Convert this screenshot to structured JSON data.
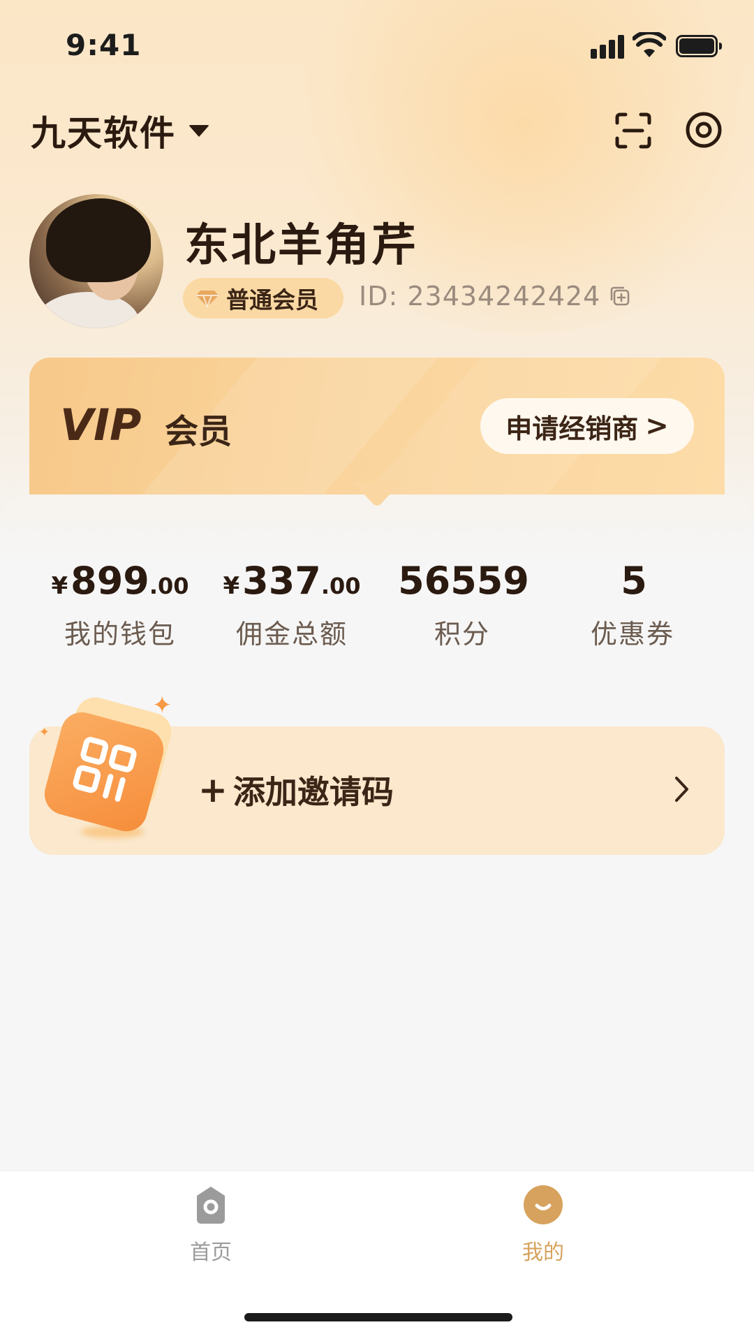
{
  "status_bar": {
    "time": "9:41"
  },
  "header": {
    "org_name": "九天软件"
  },
  "profile": {
    "name": "东北羊角芹",
    "member_level": "普通会员",
    "user_id": "ID: 23434242424"
  },
  "vip_card": {
    "logo_text": "VIP",
    "label": "会员",
    "apply_button": "申请经销商",
    "apply_chevron": ">"
  },
  "stats": [
    {
      "currency": "¥",
      "integer": "899",
      "decimal": ".00",
      "label": "我的钱包"
    },
    {
      "currency": "¥",
      "integer": "337",
      "decimal": ".00",
      "label": "佣金总额"
    },
    {
      "currency": "",
      "integer": "56559",
      "decimal": "",
      "label": "积分"
    },
    {
      "currency": "",
      "integer": "5",
      "decimal": "",
      "label": "优惠券"
    }
  ],
  "invite": {
    "plus": "+",
    "label": "添加邀请码"
  },
  "tab_bar": {
    "tabs": [
      {
        "label": "首页",
        "icon": "home-icon",
        "active": false
      },
      {
        "label": "我的",
        "icon": "profile-smile-icon",
        "active": true
      }
    ]
  },
  "colors": {
    "accent": "#f68d3b",
    "active_tab": "#d7a25d",
    "inactive_tab": "#9b9b9b",
    "text_dark": "#2b1a10"
  }
}
